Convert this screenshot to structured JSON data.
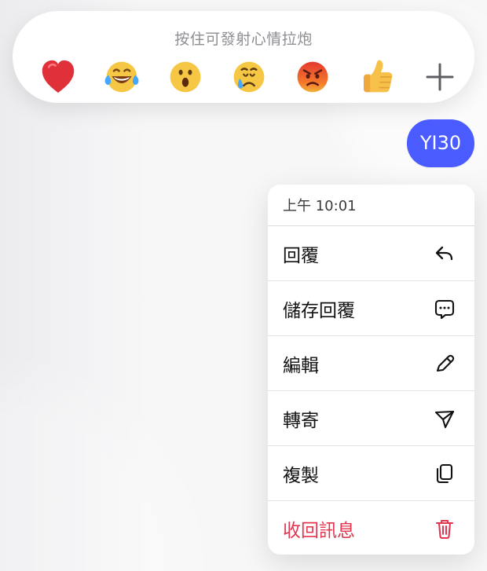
{
  "reaction_bar": {
    "hint": "按住可發射心情拉炮",
    "reactions": [
      {
        "icon": "heart-icon"
      },
      {
        "icon": "laughing-tears-icon"
      },
      {
        "icon": "surprised-face-icon"
      },
      {
        "icon": "crying-face-icon"
      },
      {
        "icon": "angry-face-icon"
      },
      {
        "icon": "thumbs-up-icon"
      },
      {
        "icon": "plus-icon"
      }
    ]
  },
  "message": {
    "text": "YI30",
    "color": "#4A5CFF"
  },
  "context_menu": {
    "time": "上午 10:01",
    "items": [
      {
        "label": "回覆",
        "icon": "reply-icon"
      },
      {
        "label": "儲存回覆",
        "icon": "message-dots-icon"
      },
      {
        "label": "編輯",
        "icon": "pencil-icon"
      },
      {
        "label": "轉寄",
        "icon": "forward-icon"
      },
      {
        "label": "複製",
        "icon": "copy-icon"
      },
      {
        "label": "收回訊息",
        "icon": "trash-icon",
        "danger": true
      }
    ],
    "danger_color": "#E4354F"
  }
}
